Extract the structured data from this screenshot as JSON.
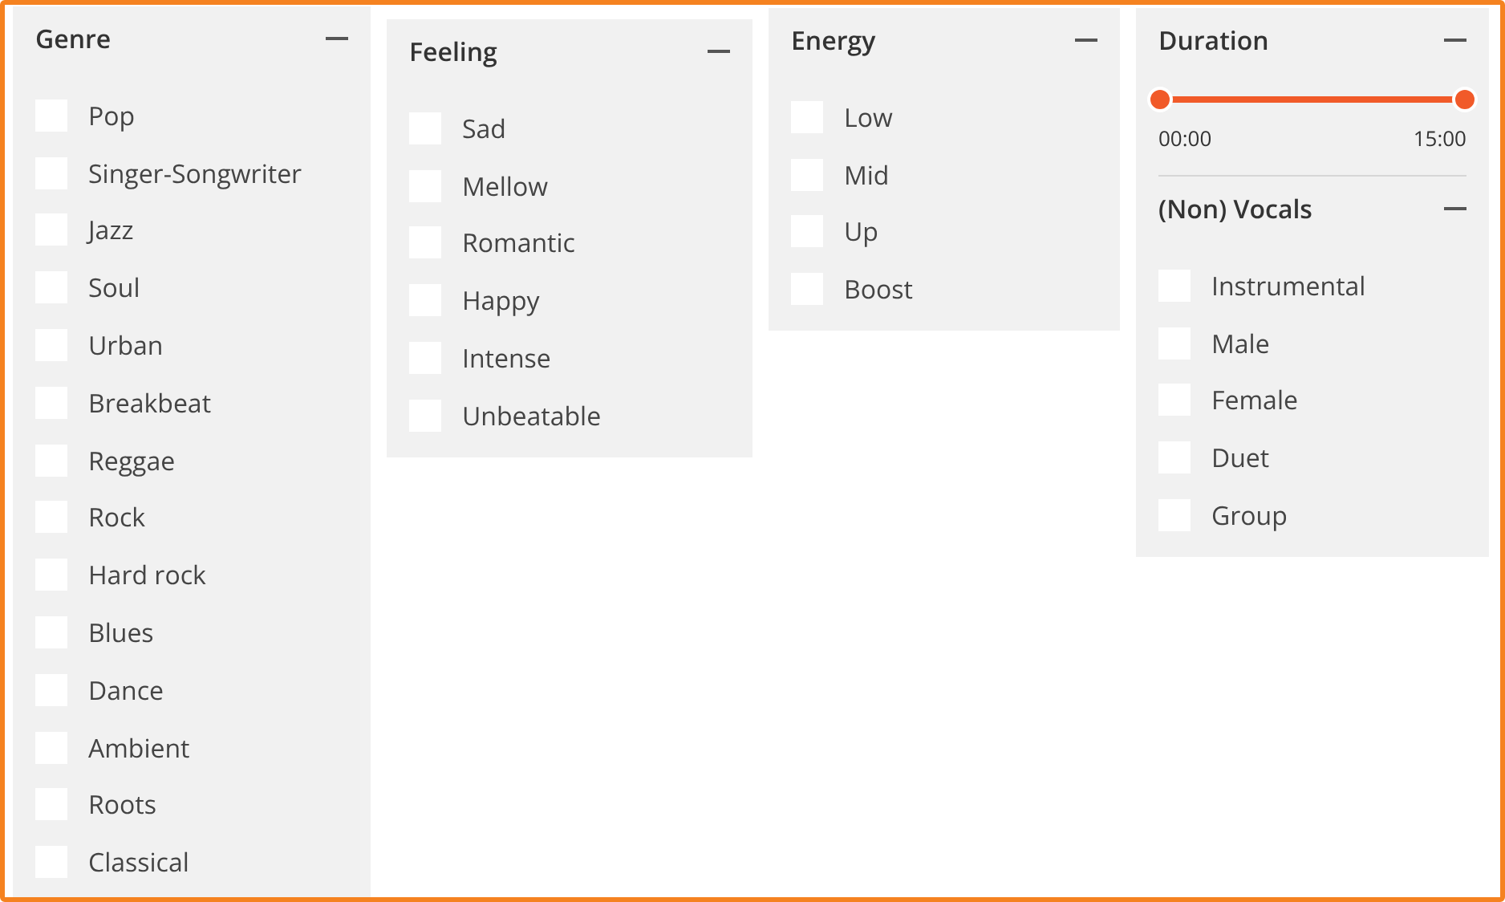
{
  "columns": [
    {
      "sections": [
        {
          "kind": "checklist",
          "title": "Genre",
          "expanded": true,
          "items": [
            {
              "label": "Pop",
              "checked": false
            },
            {
              "label": "Singer-Songwriter",
              "checked": false
            },
            {
              "label": "Jazz",
              "checked": false
            },
            {
              "label": "Soul",
              "checked": false
            },
            {
              "label": "Urban",
              "checked": false
            },
            {
              "label": "Breakbeat",
              "checked": false
            },
            {
              "label": "Reggae",
              "checked": false
            },
            {
              "label": "Rock",
              "checked": false
            },
            {
              "label": "Hard rock",
              "checked": false
            },
            {
              "label": "Blues",
              "checked": false
            },
            {
              "label": "Dance",
              "checked": false
            },
            {
              "label": "Ambient",
              "checked": false
            },
            {
              "label": "Roots",
              "checked": false
            },
            {
              "label": "Classical",
              "checked": false
            }
          ]
        }
      ]
    },
    {
      "sections": [
        {
          "kind": "checklist",
          "title": "Feeling",
          "expanded": true,
          "items": [
            {
              "label": "Sad",
              "checked": false
            },
            {
              "label": "Mellow",
              "checked": false
            },
            {
              "label": "Romantic",
              "checked": false
            },
            {
              "label": "Happy",
              "checked": false
            },
            {
              "label": "Intense",
              "checked": false
            },
            {
              "label": "Unbeatable",
              "checked": false
            }
          ]
        }
      ]
    },
    {
      "sections": [
        {
          "kind": "checklist",
          "title": "Energy",
          "expanded": true,
          "items": [
            {
              "label": "Low",
              "checked": false
            },
            {
              "label": "Mid",
              "checked": false
            },
            {
              "label": "Up",
              "checked": false
            },
            {
              "label": "Boost",
              "checked": false
            }
          ]
        }
      ]
    },
    {
      "sections": [
        {
          "kind": "range",
          "title": "Duration",
          "expanded": true,
          "low": {
            "level": 0,
            "reading": "00:00"
          },
          "high": {
            "level": 1,
            "reading": "15:00"
          }
        },
        {
          "kind": "checklist",
          "title": "(Non) Vocals",
          "expanded": true,
          "items": [
            {
              "label": "Instrumental",
              "checked": false
            },
            {
              "label": "Male",
              "checked": false
            },
            {
              "label": "Female",
              "checked": false
            },
            {
              "label": "Duet",
              "checked": false
            },
            {
              "label": "Group",
              "checked": false
            }
          ]
        }
      ]
    }
  ]
}
